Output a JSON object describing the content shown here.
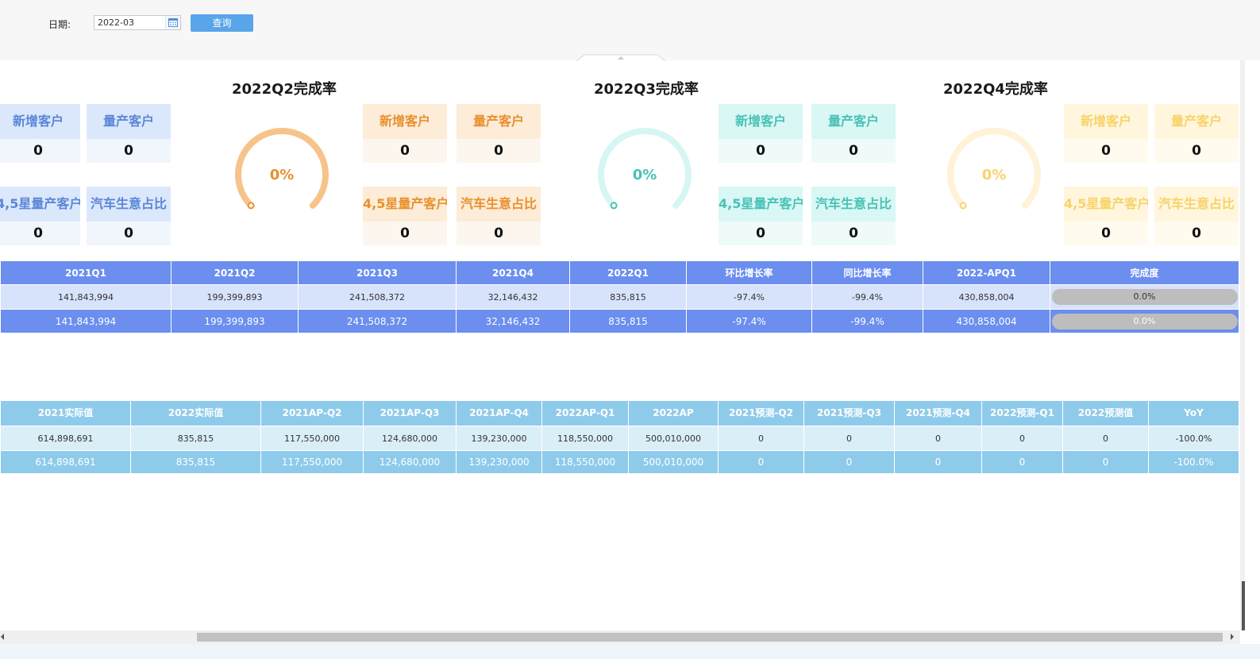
{
  "filter": {
    "date_label": "日期:",
    "date_value": "2022-03",
    "query_label": "查询"
  },
  "gauges": [
    {
      "title": "2022Q2完成率",
      "percent_text": "0%",
      "percent": 0,
      "color": "#f6c48a",
      "text_color": "#e9902c"
    },
    {
      "title": "2022Q3完成率",
      "percent_text": "0%",
      "percent": 0,
      "color": "#d6f6f4",
      "text_color": "#48c2b5"
    },
    {
      "title": "2022Q4完成率",
      "percent_text": "0%",
      "percent": 0,
      "color": "#fff2d6",
      "text_color": "#f7d36a"
    }
  ],
  "kpis": {
    "new_customers": {
      "label": "新增客户",
      "q1": "0",
      "q2": "0",
      "q3": "0",
      "q4": "0"
    },
    "mass_customers": {
      "label": "量产客户",
      "q1": "0",
      "q2": "0",
      "q3": "0",
      "q4": "0"
    },
    "star_customers": {
      "label": "4,5星量产客户",
      "q1": "0",
      "q2": "0",
      "q3": "0",
      "q4": "0"
    },
    "auto_share": {
      "label": "汽车生意占比",
      "q1": "0",
      "q2": "0",
      "q3": "0",
      "q4": "0"
    }
  },
  "table1": {
    "headers": [
      "2021Q1",
      "2021Q2",
      "2021Q3",
      "2021Q4",
      "2022Q1",
      "环比增长率",
      "同比增长率",
      "2022-APQ1",
      "完成度"
    ],
    "row1": [
      "141,843,994",
      "199,399,893",
      "241,508,372",
      "32,146,432",
      "835,815",
      "-97.4%",
      "-99.4%",
      "430,858,004",
      "0.0%"
    ],
    "row2": [
      "141,843,994",
      "199,399,893",
      "241,508,372",
      "32,146,432",
      "835,815",
      "-97.4%",
      "-99.4%",
      "430,858,004",
      "0.0%"
    ],
    "completion": 0
  },
  "table2": {
    "headers": [
      "2021实际值",
      "2022实际值",
      "2021AP-Q2",
      "2021AP-Q3",
      "2021AP-Q4",
      "2022AP-Q1",
      "2022AP",
      "2021预测-Q2",
      "2021预测-Q3",
      "2021预测-Q4",
      "2022预测-Q1",
      "2022预测值",
      "YoY"
    ],
    "row1": [
      "614,898,691",
      "835,815",
      "117,550,000",
      "124,680,000",
      "139,230,000",
      "118,550,000",
      "500,010,000",
      "0",
      "0",
      "0",
      "0",
      "0",
      "-100.0%"
    ],
    "row2": [
      "614,898,691",
      "835,815",
      "117,550,000",
      "124,680,000",
      "139,230,000",
      "118,550,000",
      "500,010,000",
      "0",
      "0",
      "0",
      "0",
      "0",
      "-100.0%"
    ]
  }
}
